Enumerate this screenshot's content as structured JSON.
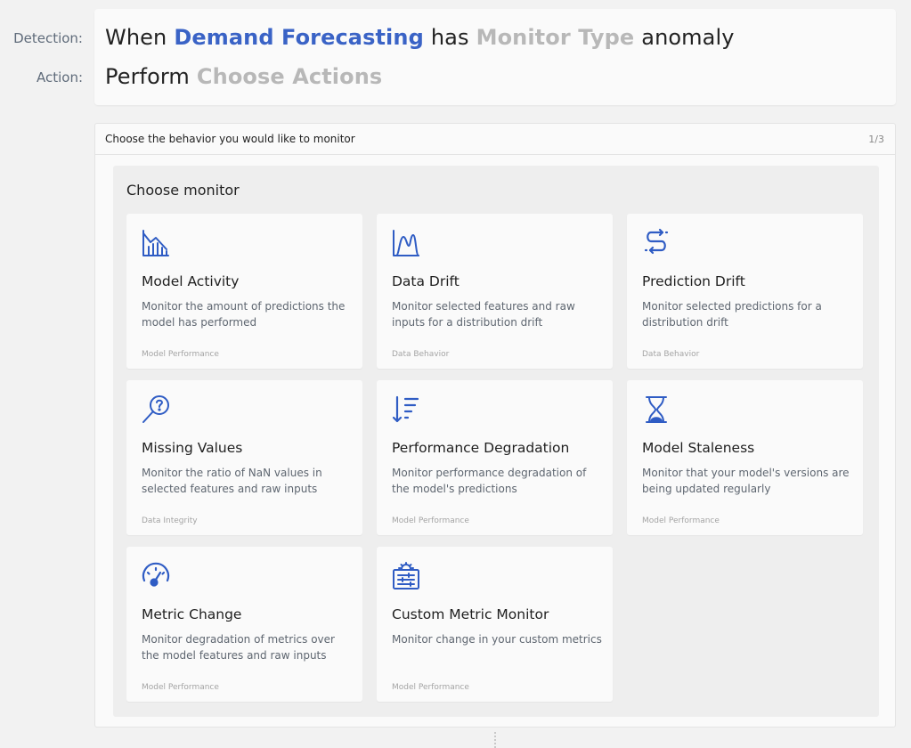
{
  "labels": {
    "detection": "Detection:",
    "action": "Action:"
  },
  "rule": {
    "when": "When",
    "model": "Demand Forecasting",
    "has": "has",
    "monitor_type": "Monitor Type",
    "anomaly": "anomaly",
    "perform": "Perform",
    "actions": "Choose Actions"
  },
  "wizard": {
    "title": "Choose the behavior you would like to monitor",
    "step": "1/3",
    "heading": "Choose monitor"
  },
  "monitors": [
    {
      "icon": "bar-chart-down-icon",
      "title": "Model Activity",
      "desc": "Monitor the amount of predictions the model has performed",
      "tag": "Model Performance"
    },
    {
      "icon": "distribution-icon",
      "title": "Data Drift",
      "desc": "Monitor selected features and raw inputs for a distribution drift",
      "tag": "Data Behavior"
    },
    {
      "icon": "drift-path-icon",
      "title": "Prediction Drift",
      "desc": "Monitor selected predictions for a distribution drift",
      "tag": "Data Behavior"
    },
    {
      "icon": "search-question-icon",
      "title": "Missing Values",
      "desc": "Monitor the ratio of NaN values in selected features and raw inputs",
      "tag": "Data Integrity"
    },
    {
      "icon": "sort-descending-icon",
      "title": "Performance Degradation",
      "desc": "Monitor performance degradation of the model's predictions",
      "tag": "Model Performance"
    },
    {
      "icon": "hourglass-icon",
      "title": "Model Staleness",
      "desc": "Monitor that your model's versions are being updated regularly",
      "tag": "Model Performance"
    },
    {
      "icon": "gauge-icon",
      "title": "Metric Change",
      "desc": "Monitor degradation of metrics over the model features and raw inputs",
      "tag": "Model Performance"
    },
    {
      "icon": "custom-metric-icon",
      "title": "Custom Metric Monitor",
      "desc": "Monitor change in your custom metrics",
      "tag": "Model Performance"
    }
  ],
  "colors": {
    "accent": "#3a63c6",
    "placeholder": "#b8b8b8",
    "icon": "#2f5cc4"
  }
}
